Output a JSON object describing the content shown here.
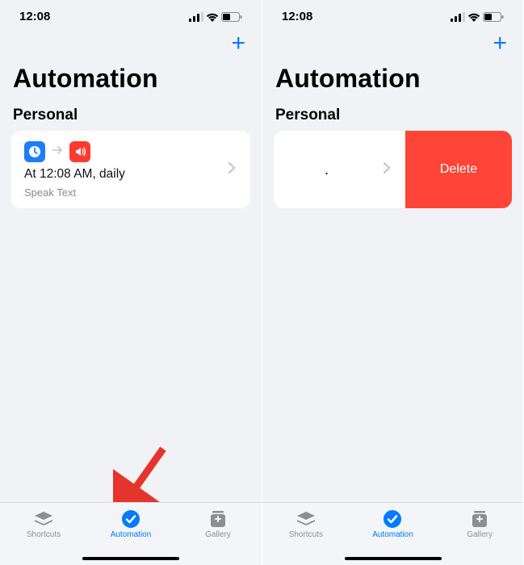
{
  "status": {
    "time": "12:08"
  },
  "header": {
    "title": "Automation",
    "sectionTitle": "Personal"
  },
  "automation": {
    "title": "At 12:08 AM, daily",
    "subtitle": "Speak Text",
    "deleteLabel": "Delete"
  },
  "tabs": {
    "shortcuts": "Shortcuts",
    "automation": "Automation",
    "gallery": "Gallery"
  },
  "colors": {
    "accent": "#007aff",
    "destructive": "#ff4438"
  }
}
